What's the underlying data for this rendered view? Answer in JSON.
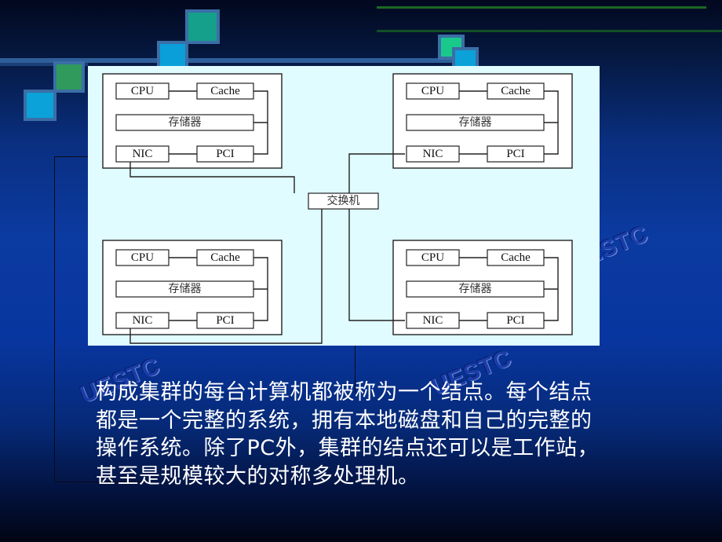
{
  "slide": {
    "watermark_text": "UESTC",
    "accent_colors": {
      "background_top": "#02081e",
      "background_mid": "#0b3aa0",
      "panel": "#e0fcff",
      "square_green": "#2e9a5a",
      "square_teal": "#1aa08a",
      "square_cyan": "#0aa0d6",
      "square_mint": "#18c88a",
      "text": "#ffffff"
    }
  },
  "diagram": {
    "switch_label": "交换机",
    "nodes": [
      {
        "id": "top-left",
        "cpu": "CPU",
        "cache": "Cache",
        "memory": "存储器",
        "nic": "NIC",
        "pci": "PCI"
      },
      {
        "id": "top-right",
        "cpu": "CPU",
        "cache": "Cache",
        "memory": "存储器",
        "nic": "NIC",
        "pci": "PCI"
      },
      {
        "id": "bottom-left",
        "cpu": "CPU",
        "cache": "Cache",
        "memory": "存储器",
        "nic": "NIC",
        "pci": "PCI"
      },
      {
        "id": "bottom-right",
        "cpu": "CPU",
        "cache": "Cache",
        "memory": "存储器",
        "nic": "NIC",
        "pci": "PCI"
      }
    ]
  },
  "paragraph": {
    "lines": [
      "构成集群的每台计算机都被称为一个结点。每个结点",
      "都是一个完整的系统，拥有本地磁盘和自己的完整的",
      "操作系统。除了PC外，集群的结点还可以是工作站，",
      "甚至是规模较大的对称多处理机。"
    ]
  }
}
